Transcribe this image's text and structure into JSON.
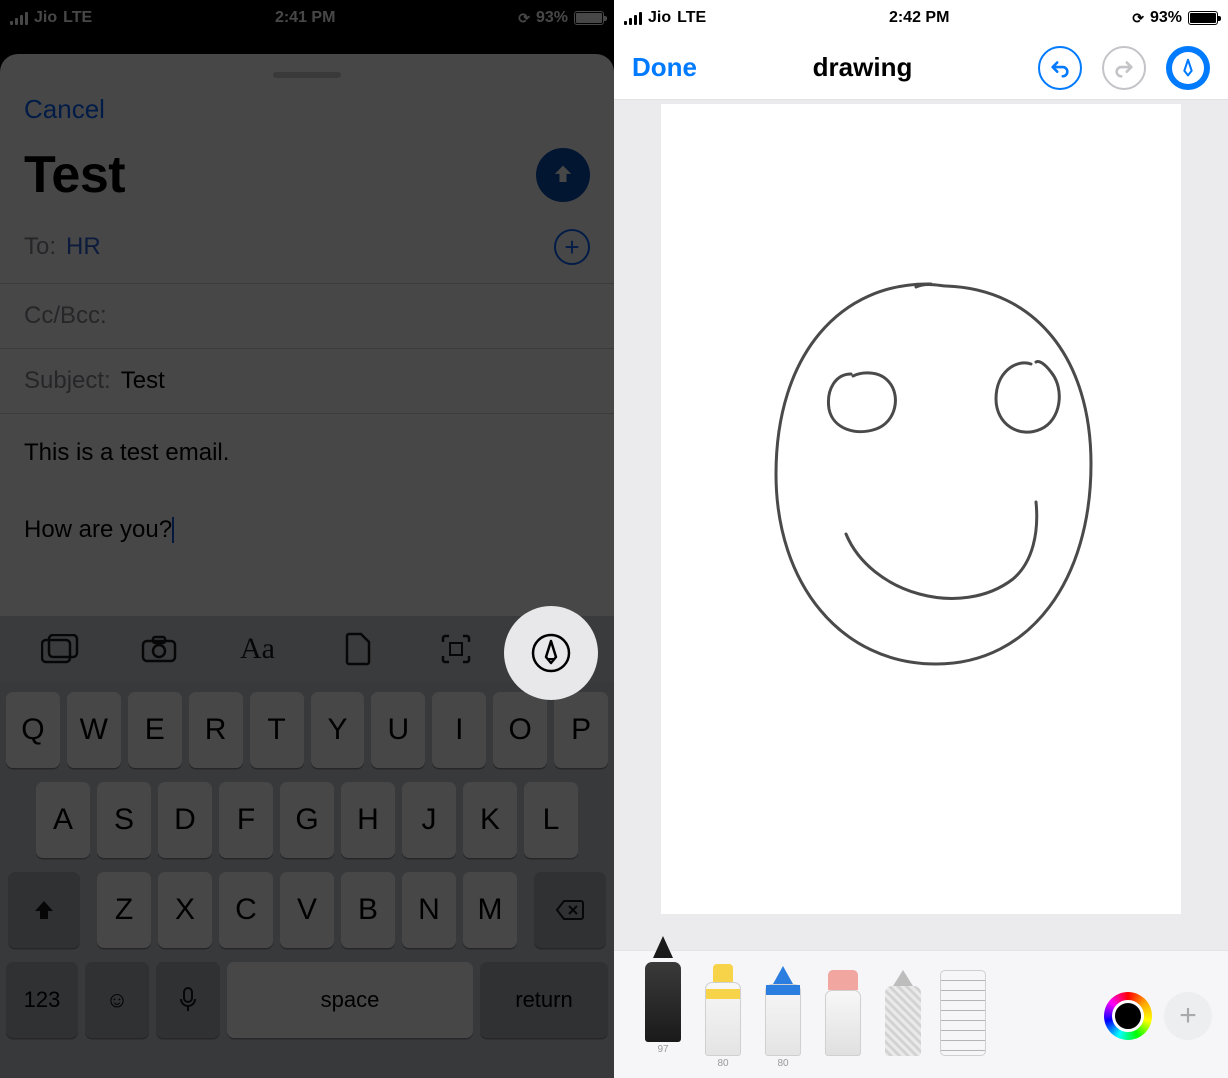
{
  "left": {
    "status": {
      "carrier": "Jio",
      "network": "LTE",
      "time": "2:41 PM",
      "battery": "93%"
    },
    "cancel": "Cancel",
    "title": "Test",
    "fields": {
      "to_label": "To:",
      "to_value": "HR",
      "cc_label": "Cc/Bcc:",
      "subject_label": "Subject:",
      "subject_value": "Test"
    },
    "body": {
      "line1": "This is a test email.",
      "line2": "How are you?"
    },
    "keyboard": {
      "row1": [
        "Q",
        "W",
        "E",
        "R",
        "T",
        "Y",
        "U",
        "I",
        "O",
        "P"
      ],
      "row2": [
        "A",
        "S",
        "D",
        "F",
        "G",
        "H",
        "J",
        "K",
        "L"
      ],
      "row3": [
        "Z",
        "X",
        "C",
        "V",
        "B",
        "N",
        "M"
      ],
      "numbers": "123",
      "space": "space",
      "return": "return"
    }
  },
  "right": {
    "status": {
      "carrier": "Jio",
      "network": "LTE",
      "time": "2:42 PM",
      "battery": "93%"
    },
    "nav": {
      "done": "Done",
      "title": "drawing"
    },
    "tool_labels": {
      "pen": "97",
      "marker": "80",
      "pencil": "80"
    }
  }
}
